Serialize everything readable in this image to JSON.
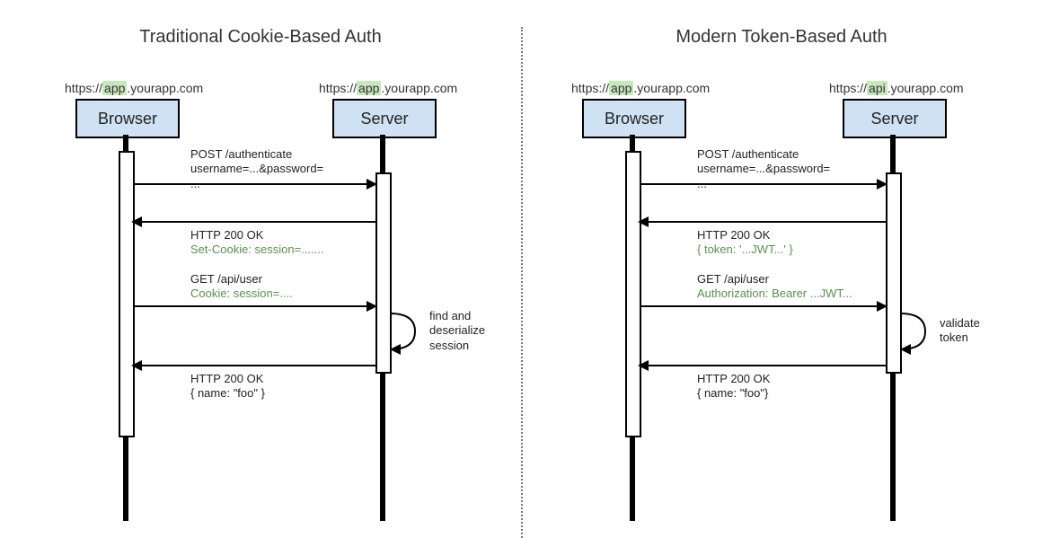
{
  "left": {
    "title": "Traditional Cookie-Based Auth",
    "browser_label": "Browser",
    "server_label": "Server",
    "browser_url_pre": "https://",
    "browser_url_hl": "app",
    "browser_url_post": ".yourapp.com",
    "server_url_pre": "https://",
    "server_url_hl": "app",
    "server_url_post": ".yourapp.com",
    "msg1_line1": "POST /authenticate",
    "msg1_line2": "username=...&password=",
    "msg1_line3": "...",
    "msg2_line1": "HTTP 200 OK",
    "msg2_line2": "Set-Cookie: session=.......",
    "msg3_line1": "GET /api/user",
    "msg3_line2": "Cookie: session=....",
    "self_note_line1": "find and",
    "self_note_line2": "deserialize",
    "self_note_line3": "session",
    "msg4_line1": "HTTP 200 OK",
    "msg4_line2": "{  name: \"foo\" }"
  },
  "right": {
    "title": "Modern Token-Based Auth",
    "browser_label": "Browser",
    "server_label": "Server",
    "browser_url_pre": "https://",
    "browser_url_hl": "app",
    "browser_url_post": ".yourapp.com",
    "server_url_pre": "https://",
    "server_url_hl": "api",
    "server_url_post": ".yourapp.com",
    "msg1_line1": "POST /authenticate",
    "msg1_line2": "username=...&password=",
    "msg1_line3": "...",
    "msg2_line1": "HTTP 200 OK",
    "msg2_line2": "{ token: '...JWT...' }",
    "msg3_line1": "GET /api/user",
    "msg3_line2": "Authorization: Bearer ...JWT...",
    "self_note_line1": "validate",
    "self_note_line2": "token",
    "msg4_line1": "HTTP 200 OK",
    "msg4_line2": "{ name: \"foo\"}"
  }
}
